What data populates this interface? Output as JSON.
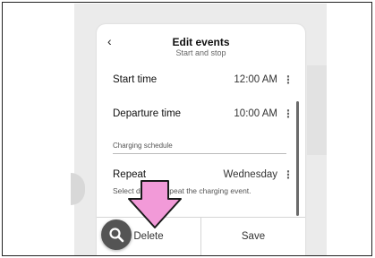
{
  "header": {
    "title": "Edit events",
    "subtitle": "Start and stop"
  },
  "rows": [
    {
      "label": "Start time",
      "value": "12:00 AM"
    },
    {
      "label": "Departure time",
      "value": "10:00 AM"
    }
  ],
  "section": {
    "label": "Charging schedule"
  },
  "repeat": {
    "label": "Repeat",
    "value": "Wednesday",
    "description": "Select days to repeat the charging event."
  },
  "footer": {
    "delete_label": "Delete",
    "save_label": "Save"
  },
  "colors": {
    "arrow_fill": "#f29ad8",
    "fab_background": "#545454"
  },
  "icons": {
    "back": "chevron-left-icon",
    "more": "more-vertical-icon",
    "arrow": "down-arrow-icon",
    "search": "search-icon"
  }
}
